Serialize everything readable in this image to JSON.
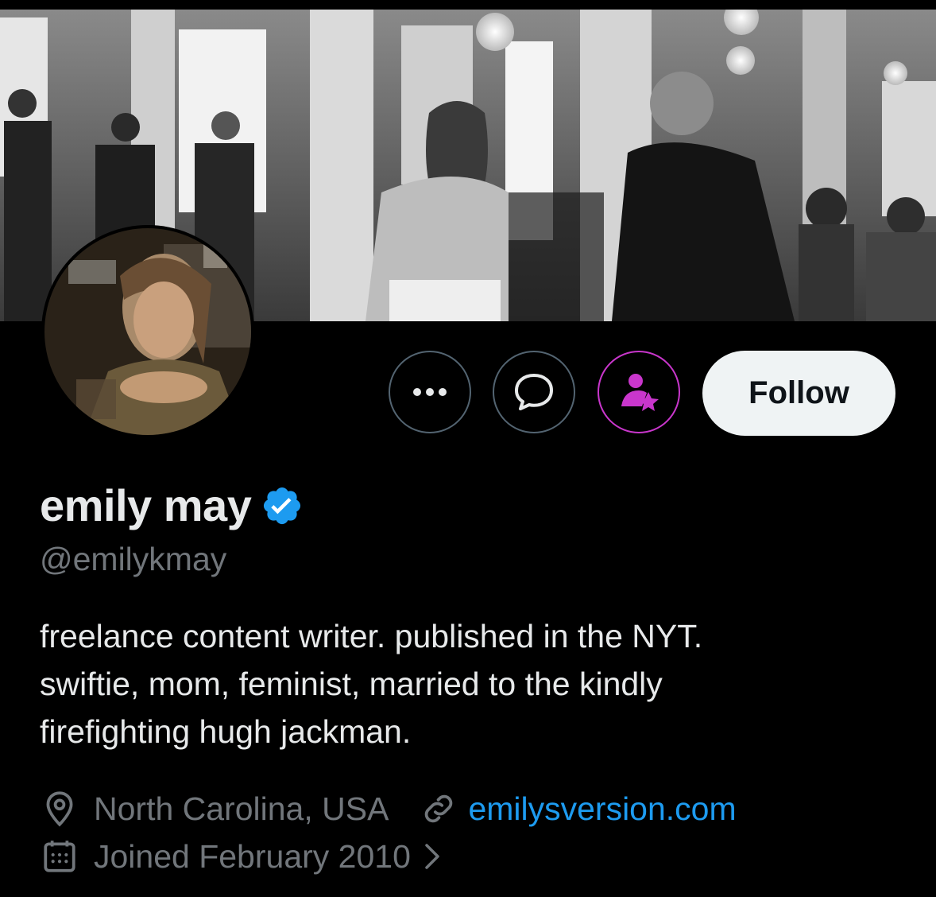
{
  "profile": {
    "display_name": "emily may",
    "handle": "@emilykmay",
    "verified_icon": "verified-badge-icon",
    "bio_lines": [
      "freelance content writer. published in the NYT.",
      "swiftie, mom, feminist, married to the kindly",
      "firefighting hugh jackman."
    ],
    "location": "North Carolina, USA",
    "website": "emilysversion.com",
    "joined": "Joined February 2010"
  },
  "actions": {
    "more_icon": "more-horizontal-icon",
    "message_icon": "message-bubble-icon",
    "subscribe_icon": "person-star-icon",
    "follow_label": "Follow"
  },
  "colors": {
    "background": "#000000",
    "primary_text": "#e7e9ea",
    "secondary_text": "#71767b",
    "link": "#1d9bf0",
    "verified": "#1d9bf0",
    "subscribe_accent": "#c936cc",
    "follow_bg": "#eff3f4"
  }
}
